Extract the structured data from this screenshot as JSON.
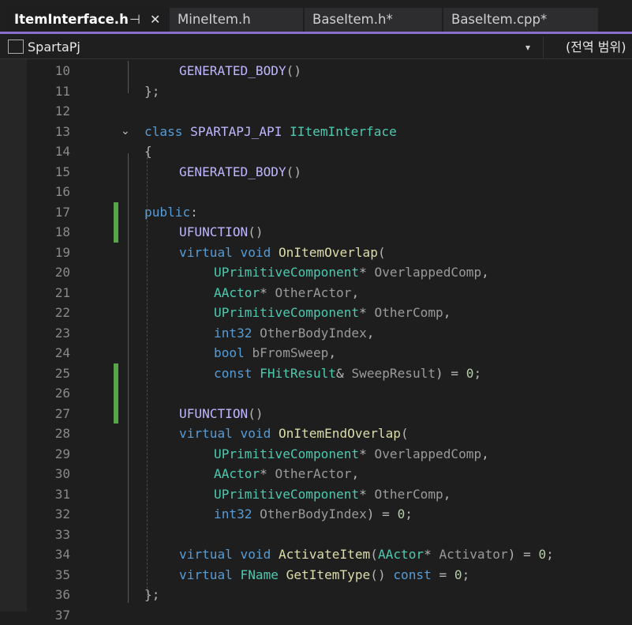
{
  "tabs": [
    {
      "label": "ItemInterface.h",
      "active": true
    },
    {
      "label": "MineItem.h",
      "active": false
    },
    {
      "label": "BaseItem.h*",
      "active": false
    },
    {
      "label": "BaseItem.cpp*",
      "active": false
    }
  ],
  "tab_icons": {
    "pin": "⊣",
    "close": "✕"
  },
  "nav": {
    "project": "SpartaPj",
    "scope": "(전역 범위)",
    "dropdown_icon": "▾"
  },
  "line_numbers": [
    "10",
    "11",
    "12",
    "13",
    "14",
    "15",
    "16",
    "17",
    "18",
    "19",
    "20",
    "21",
    "22",
    "23",
    "24",
    "25",
    "26",
    "27",
    "28",
    "29",
    "30",
    "31",
    "32",
    "33",
    "34",
    "35",
    "36",
    "37"
  ],
  "code_lines": [
    [
      [
        "GENERATED_BODY",
        "mac"
      ],
      [
        "()",
        "pu"
      ]
    ],
    [
      [
        "};",
        "pu"
      ]
    ],
    [],
    [
      [
        "class ",
        "kw"
      ],
      [
        "SPARTAPJ_API ",
        "mac"
      ],
      [
        "IItemInterface",
        "ty"
      ]
    ],
    [
      [
        "{",
        "pu"
      ]
    ],
    [
      [
        "GENERATED_BODY",
        "mac"
      ],
      [
        "()",
        "pu"
      ]
    ],
    [],
    [
      [
        "public",
        "kw"
      ],
      [
        ":",
        "pu"
      ]
    ],
    [
      [
        "UFUNCTION",
        "mac"
      ],
      [
        "()",
        "pu"
      ]
    ],
    [
      [
        "virtual ",
        "kw"
      ],
      [
        "void ",
        "kw"
      ],
      [
        "OnItemOverlap",
        "fn"
      ],
      [
        "(",
        "pu"
      ]
    ],
    [
      [
        "UPrimitiveComponent",
        "ty"
      ],
      [
        "* ",
        "pu"
      ],
      [
        "OverlappedComp",
        "pa"
      ],
      [
        ",",
        "pu"
      ]
    ],
    [
      [
        "AActor",
        "ty"
      ],
      [
        "* ",
        "pu"
      ],
      [
        "OtherActor",
        "pa"
      ],
      [
        ",",
        "pu"
      ]
    ],
    [
      [
        "UPrimitiveComponent",
        "ty"
      ],
      [
        "* ",
        "pu"
      ],
      [
        "OtherComp",
        "pa"
      ],
      [
        ",",
        "pu"
      ]
    ],
    [
      [
        "int32 ",
        "kw"
      ],
      [
        "OtherBodyIndex",
        "pa"
      ],
      [
        ",",
        "pu"
      ]
    ],
    [
      [
        "bool ",
        "kw"
      ],
      [
        "bFromSweep",
        "pa"
      ],
      [
        ",",
        "pu"
      ]
    ],
    [
      [
        "const ",
        "kw"
      ],
      [
        "FHitResult",
        "ty"
      ],
      [
        "& ",
        "pu"
      ],
      [
        "SweepResult",
        "pa"
      ],
      [
        ") = ",
        "pu"
      ],
      [
        "0",
        "nu"
      ],
      [
        ";",
        "pu"
      ]
    ],
    [],
    [
      [
        "UFUNCTION",
        "mac"
      ],
      [
        "()",
        "pu"
      ]
    ],
    [
      [
        "virtual ",
        "kw"
      ],
      [
        "void ",
        "kw"
      ],
      [
        "OnItemEndOverlap",
        "fn"
      ],
      [
        "(",
        "pu"
      ]
    ],
    [
      [
        "UPrimitiveComponent",
        "ty"
      ],
      [
        "* ",
        "pu"
      ],
      [
        "OverlappedComp",
        "pa"
      ],
      [
        ",",
        "pu"
      ]
    ],
    [
      [
        "AActor",
        "ty"
      ],
      [
        "* ",
        "pu"
      ],
      [
        "OtherActor",
        "pa"
      ],
      [
        ",",
        "pu"
      ]
    ],
    [
      [
        "UPrimitiveComponent",
        "ty"
      ],
      [
        "* ",
        "pu"
      ],
      [
        "OtherComp",
        "pa"
      ],
      [
        ",",
        "pu"
      ]
    ],
    [
      [
        "int32 ",
        "kw"
      ],
      [
        "OtherBodyIndex",
        "pa"
      ],
      [
        ") = ",
        "pu"
      ],
      [
        "0",
        "nu"
      ],
      [
        ";",
        "pu"
      ]
    ],
    [],
    [
      [
        "virtual ",
        "kw"
      ],
      [
        "void ",
        "kw"
      ],
      [
        "ActivateItem",
        "fn"
      ],
      [
        "(",
        "pu"
      ],
      [
        "AActor",
        "ty"
      ],
      [
        "* ",
        "pu"
      ],
      [
        "Activator",
        "pa"
      ],
      [
        ") = ",
        "pu"
      ],
      [
        "0",
        "nu"
      ],
      [
        ";",
        "pu"
      ]
    ],
    [
      [
        "virtual ",
        "kw"
      ],
      [
        "FName ",
        "ty"
      ],
      [
        "GetItemType",
        "fn"
      ],
      [
        "() ",
        "pu"
      ],
      [
        "const",
        "kw"
      ],
      [
        " = ",
        "pu"
      ],
      [
        "0",
        "nu"
      ],
      [
        ";",
        "pu"
      ]
    ],
    [
      [
        "};",
        "pu"
      ]
    ],
    []
  ],
  "indent_levels": [
    1,
    0,
    0,
    0,
    0,
    1,
    0,
    0,
    1,
    1,
    2,
    2,
    2,
    2,
    2,
    2,
    0,
    1,
    1,
    2,
    2,
    2,
    2,
    0,
    1,
    1,
    0,
    0
  ],
  "fold_icon": "⌄",
  "fold_lines": [
    3
  ],
  "change_marks": [
    7,
    8,
    15,
    16,
    17
  ]
}
